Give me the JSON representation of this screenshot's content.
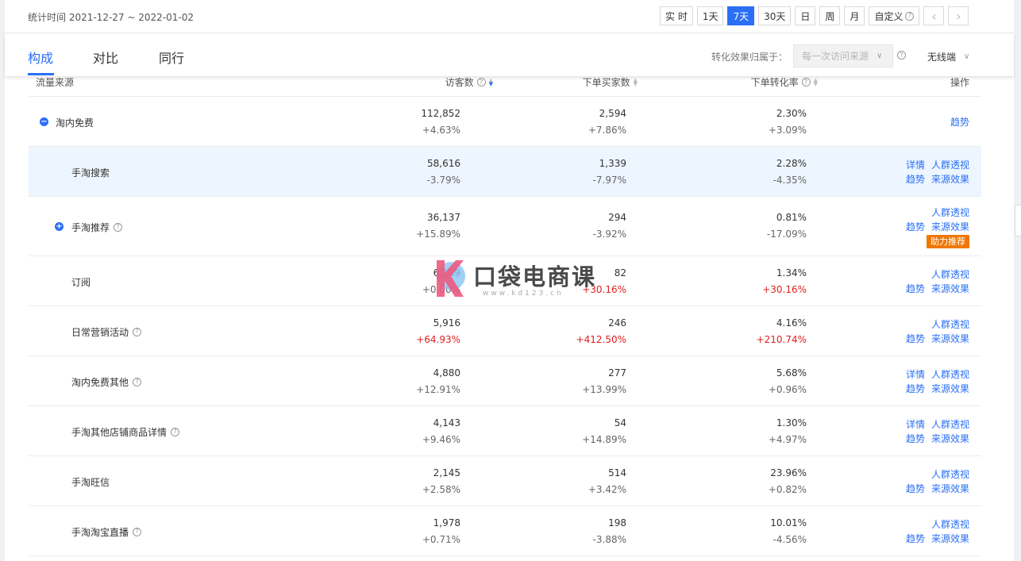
{
  "stat_range": "统计时间 2021-12-27 ~ 2022-01-02",
  "periods": [
    {
      "label": "实 时",
      "active": false
    },
    {
      "label": "1天",
      "active": false
    },
    {
      "label": "7天",
      "active": true
    },
    {
      "label": "30天",
      "active": false
    },
    {
      "label": "日",
      "active": false
    },
    {
      "label": "周",
      "active": false
    },
    {
      "label": "月",
      "active": false
    }
  ],
  "custom_label": "自定义",
  "prev_icon": "chevron-left-icon",
  "next_icon": "chevron-right-icon",
  "tabs": [
    {
      "label": "构成",
      "active": true
    },
    {
      "label": "对比",
      "active": false
    },
    {
      "label": "同行",
      "active": false
    }
  ],
  "attribution_label": "转化效果归属于：",
  "attribution_value": "每一次访问来源",
  "device": "无线端",
  "table": {
    "headers": {
      "source": "流量来源",
      "visitors": "访客数",
      "buyers": "下单买家数",
      "rate": "下单转化率",
      "ops": "操作"
    },
    "rows": [
      {
        "name": "淘内免费",
        "level": 0,
        "toggle": "minus",
        "help": false,
        "visitors": "112,852",
        "visitors_chg": "+4.63%",
        "buyers": "2,594",
        "buyers_chg": "+7.86%",
        "rate": "2.30%",
        "rate_chg": "+3.09%",
        "ops_line1": [],
        "ops_line2": [
          "趋势"
        ],
        "highlight": false
      },
      {
        "name": "手淘搜索",
        "level": 1,
        "toggle": "",
        "help": false,
        "visitors": "58,616",
        "visitors_chg": "-3.79%",
        "buyers": "1,339",
        "buyers_chg": "-7.97%",
        "rate": "2.28%",
        "rate_chg": "-4.35%",
        "ops_line1": [
          "详情",
          "人群透视"
        ],
        "ops_line2": [
          "趋势",
          "来源效果"
        ],
        "highlight": true
      },
      {
        "name": "手淘推荐",
        "level": 1,
        "toggle": "plus",
        "help": true,
        "visitors": "36,137",
        "visitors_chg": "+15.89%",
        "buyers": "294",
        "buyers_chg": "-3.92%",
        "rate": "0.81%",
        "rate_chg": "-17.09%",
        "ops_line1": [
          "人群透视"
        ],
        "ops_line2": [
          "趋势",
          "来源效果"
        ],
        "badge": "助力推荐",
        "highlight": false
      },
      {
        "name": "订阅",
        "level": 1,
        "toggle": "",
        "help": false,
        "visitors": "6,109",
        "visitors_chg": "+0.00%",
        "buyers": "82",
        "buyers_chg": "+30.16%",
        "rate": "1.34%",
        "rate_chg": "+30.16%",
        "ops_line1": [
          "人群透视"
        ],
        "ops_line2": [
          "趋势",
          "来源效果"
        ],
        "highlight": false
      },
      {
        "name": "日常营销活动",
        "level": 1,
        "toggle": "",
        "help": true,
        "visitors": "5,916",
        "visitors_chg": "+64.93%",
        "buyers": "246",
        "buyers_chg": "+412.50%",
        "rate": "4.16%",
        "rate_chg": "+210.74%",
        "ops_line1": [
          "人群透视"
        ],
        "ops_line2": [
          "趋势",
          "来源效果"
        ],
        "highlight": false
      },
      {
        "name": "淘内免费其他",
        "level": 1,
        "toggle": "",
        "help": true,
        "visitors": "4,880",
        "visitors_chg": "+12.91%",
        "buyers": "277",
        "buyers_chg": "+13.99%",
        "rate": "5.68%",
        "rate_chg": "+0.96%",
        "ops_line1": [
          "详情",
          "人群透视"
        ],
        "ops_line2": [
          "趋势",
          "来源效果"
        ],
        "highlight": false
      },
      {
        "name": "手淘其他店铺商品详情",
        "level": 1,
        "toggle": "",
        "help": true,
        "visitors": "4,143",
        "visitors_chg": "+9.46%",
        "buyers": "54",
        "buyers_chg": "+14.89%",
        "rate": "1.30%",
        "rate_chg": "+4.97%",
        "ops_line1": [
          "详情",
          "人群透视"
        ],
        "ops_line2": [
          "趋势",
          "来源效果"
        ],
        "highlight": false
      },
      {
        "name": "手淘旺信",
        "level": 1,
        "toggle": "",
        "help": false,
        "visitors": "2,145",
        "visitors_chg": "+2.58%",
        "buyers": "514",
        "buyers_chg": "+3.42%",
        "rate": "23.96%",
        "rate_chg": "+0.82%",
        "ops_line1": [
          "人群透视"
        ],
        "ops_line2": [
          "趋势",
          "来源效果"
        ],
        "highlight": false
      },
      {
        "name": "手淘淘宝直播",
        "level": 1,
        "toggle": "",
        "help": true,
        "visitors": "1,978",
        "visitors_chg": "+0.71%",
        "buyers": "198",
        "buyers_chg": "-3.88%",
        "rate": "10.01%",
        "rate_chg": "-4.56%",
        "ops_line1": [
          "人群透视"
        ],
        "ops_line2": [
          "趋势",
          "来源效果"
        ],
        "highlight": false
      }
    ]
  },
  "watermark": {
    "logo_letter": "K",
    "text": "口袋电商课",
    "url": "www.kd123.cn"
  }
}
